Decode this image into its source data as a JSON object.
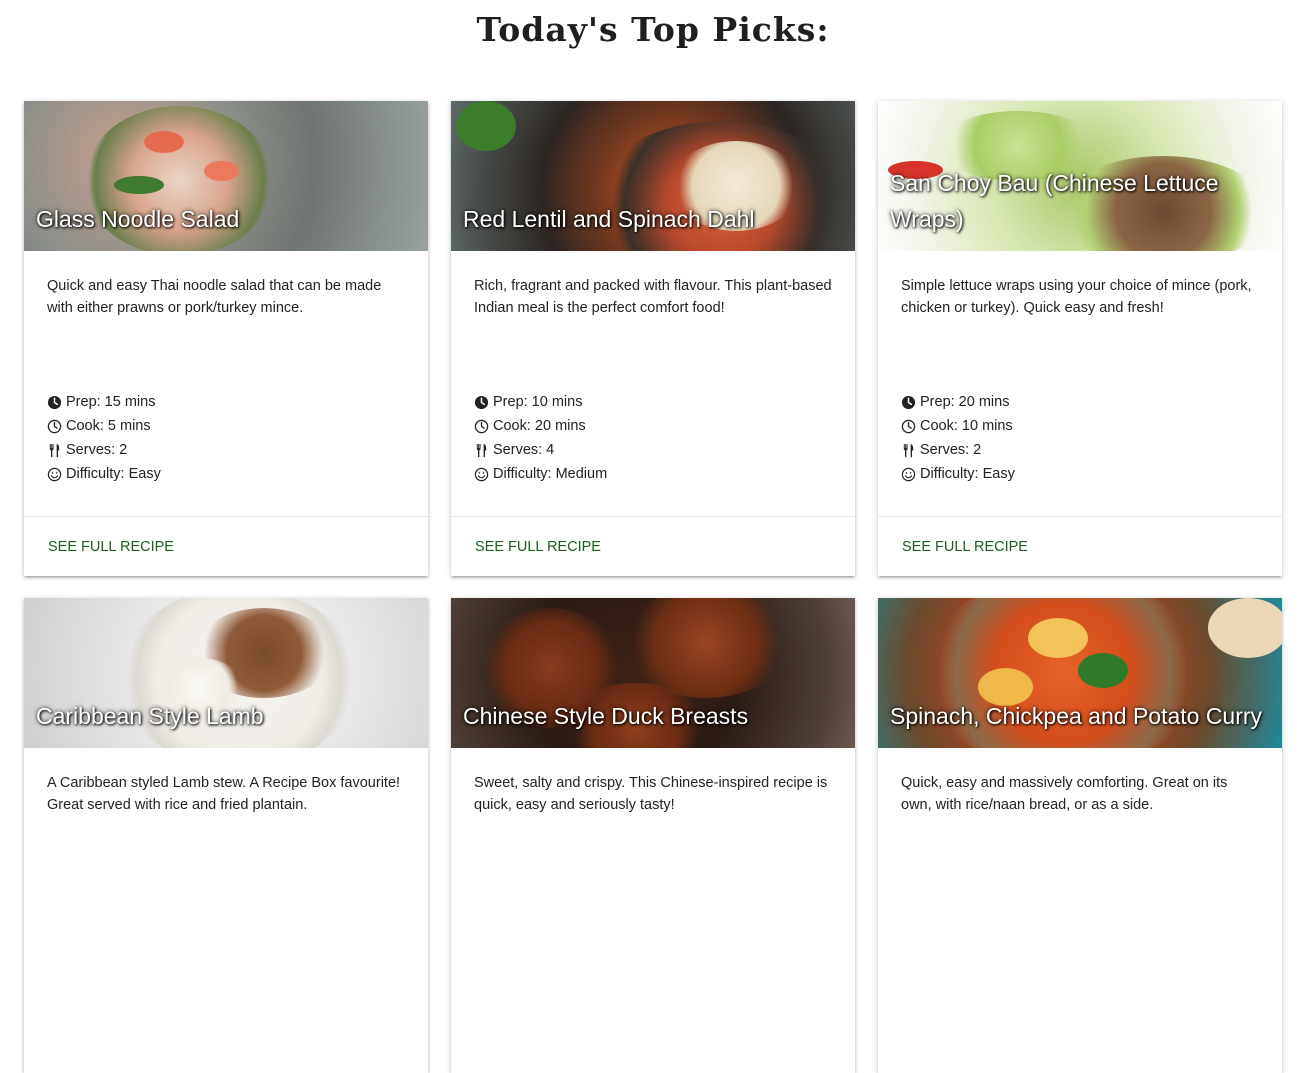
{
  "header": {
    "title": "Today's Top Picks:"
  },
  "cards": [
    {
      "title": "Glass Noodle Salad",
      "description": "Quick and easy Thai noodle salad that can be made with either prawns or pork/turkey mince.",
      "prep": "Prep: 15 mins",
      "cook": "Cook: 5 mins",
      "serves": "Serves: 2",
      "difficulty": "Difficulty: Easy",
      "action": "SEE FULL RECIPE"
    },
    {
      "title": "Red Lentil and Spinach Dahl",
      "description": "Rich, fragrant and packed with flavour. This plant-based Indian meal is the perfect comfort food!",
      "prep": "Prep: 10 mins",
      "cook": "Cook: 20 mins",
      "serves": "Serves: 4",
      "difficulty": "Difficulty: Medium",
      "action": "SEE FULL RECIPE"
    },
    {
      "title": "San Choy Bau (Chinese Lettuce Wraps)",
      "description": "Simple lettuce wraps using your choice of mince (pork, chicken or turkey). Quick easy and fresh!",
      "prep": "Prep: 20 mins",
      "cook": "Cook: 10 mins",
      "serves": "Serves: 2",
      "difficulty": "Difficulty: Easy",
      "action": "SEE FULL RECIPE"
    },
    {
      "title": "Caribbean Style Lamb",
      "description": "A Caribbean styled Lamb stew. A Recipe Box favourite! Great served with rice and fried plantain.",
      "prep": "",
      "cook": "",
      "serves": "",
      "difficulty": "",
      "action": ""
    },
    {
      "title": "Chinese Style Duck Breasts",
      "description": "Sweet, salty and crispy. This Chinese-inspired recipe is quick, easy and seriously tasty!",
      "prep": "",
      "cook": "",
      "serves": "",
      "difficulty": "",
      "action": ""
    },
    {
      "title": "Spinach, Chickpea and Potato Curry",
      "description": "Quick, easy and massively comforting. Great on its own, with rice/naan bread, or as a side.",
      "prep": "",
      "cook": "",
      "serves": "",
      "difficulty": "",
      "action": ""
    }
  ],
  "icons": {
    "prep": "clock-filled-icon",
    "cook": "clock-outline-icon",
    "serves": "cutlery-icon",
    "difficulty": "smiley-icon"
  },
  "colors": {
    "accent": "#1b5e20",
    "title_text": "#1f1f1f"
  }
}
